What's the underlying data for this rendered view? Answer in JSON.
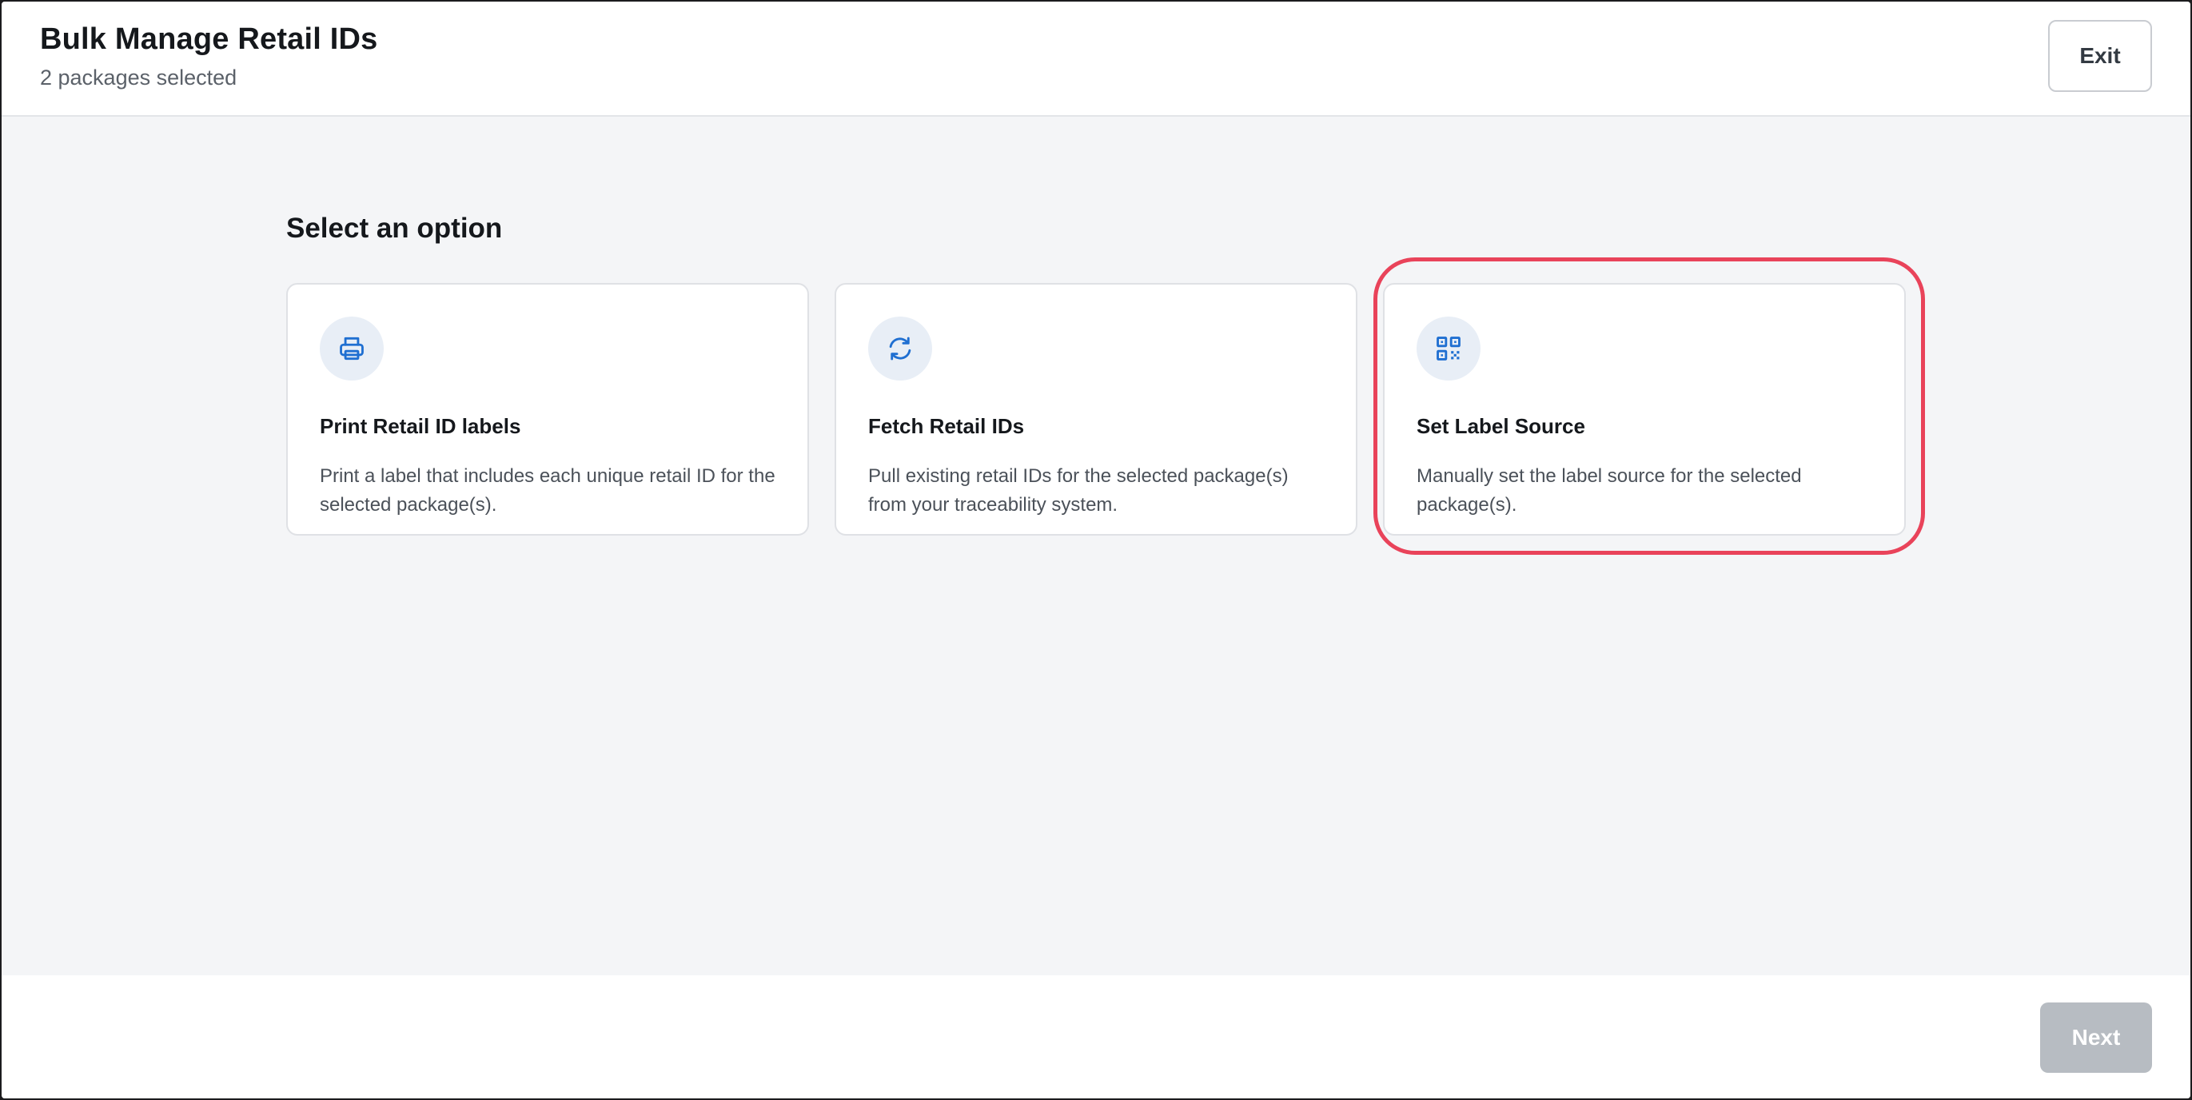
{
  "header": {
    "title": "Bulk Manage Retail IDs",
    "subtitle": "2 packages selected",
    "exit_label": "Exit"
  },
  "main": {
    "section_title": "Select an option",
    "options": [
      {
        "icon": "printer-icon",
        "title": "Print Retail ID labels",
        "description": "Print a label that includes each unique retail ID for the selected package(s)."
      },
      {
        "icon": "refresh-icon",
        "title": "Fetch Retail IDs",
        "description": "Pull existing retail IDs for the selected package(s) from your traceability system."
      },
      {
        "icon": "qr-code-icon",
        "title": "Set Label Source",
        "description": "Manually set the label source for the selected package(s).",
        "highlighted": true
      }
    ]
  },
  "footer": {
    "next_label": "Next",
    "next_disabled": true
  },
  "colors": {
    "icon_blue": "#1f6fd1",
    "icon_bg": "#e8eef6",
    "highlight_red": "#e9435a",
    "disabled_button": "#b7bcc2"
  }
}
